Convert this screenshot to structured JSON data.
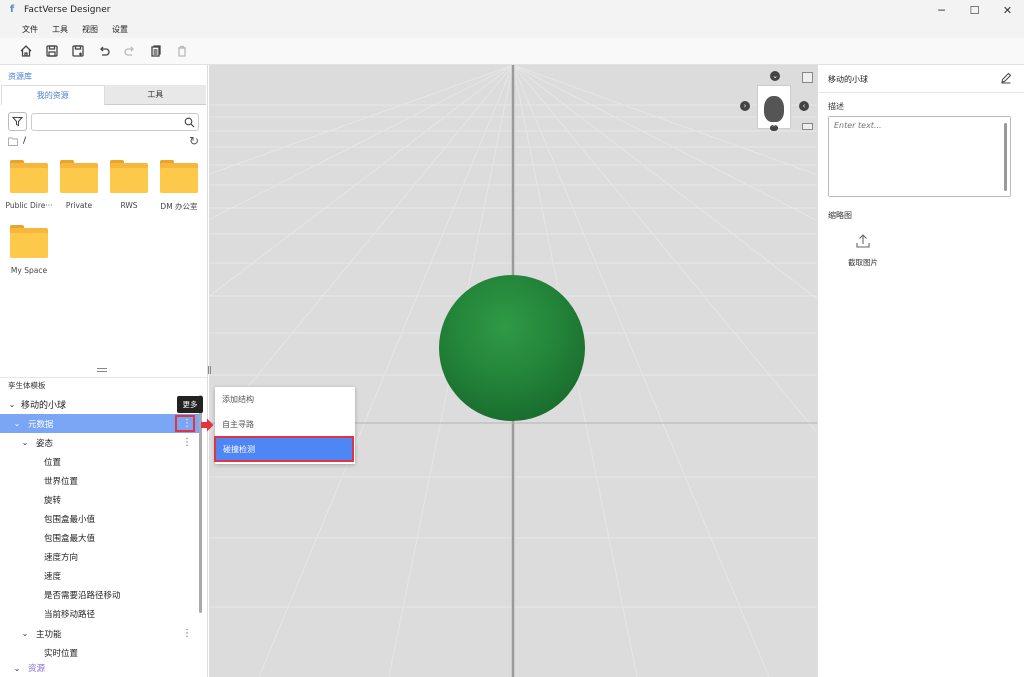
{
  "window": {
    "title": "FactVerse Designer",
    "minimize": "─",
    "maximize": "☐",
    "close": "✕"
  },
  "menu": [
    "文件",
    "工具",
    "视图",
    "设置"
  ],
  "toolbar": [
    "home-icon",
    "save-icon",
    "save-as-icon",
    "undo-icon",
    "redo-icon",
    "copy-icon",
    "delete-icon"
  ],
  "left": {
    "header": "资源库",
    "tabs": [
      "我的资源",
      "工具"
    ],
    "search_placeholder": "",
    "path": "/",
    "folders": [
      "Public Dire···",
      "Private",
      "RWS",
      "DM 办公室",
      "My Space"
    ],
    "tree_header": "孪生体模板",
    "tree": [
      {
        "label": "移动的小球",
        "chev": "⌄"
      },
      {
        "label": "元数据",
        "chev": "⌄"
      },
      {
        "label": "姿态",
        "chev": "⌄"
      },
      {
        "label": "位置"
      },
      {
        "label": "世界位置"
      },
      {
        "label": "旋转"
      },
      {
        "label": "包围盒最小值"
      },
      {
        "label": "包围盒最大值"
      },
      {
        "label": "速度方向"
      },
      {
        "label": "速度"
      },
      {
        "label": "是否需要沿路径移动"
      },
      {
        "label": "当前移动路径"
      },
      {
        "label": "主功能",
        "chev": "⌄"
      },
      {
        "label": "实时位置"
      },
      {
        "label": "资源",
        "chev": "⌄"
      }
    ],
    "tooltip": "更多"
  },
  "context_menu": [
    "添加结构",
    "自主寻路",
    "碰撞检测"
  ],
  "right": {
    "title": "移动的小球",
    "desc_label": "描述",
    "desc_placeholder": "Enter text...",
    "thumb_label": "缩略图",
    "capture_label": "截取图片"
  },
  "colors": {
    "accent": "#4e86f5",
    "highlight": "#e23340",
    "sphere": "#24863a",
    "folder": "#fcc94a"
  }
}
